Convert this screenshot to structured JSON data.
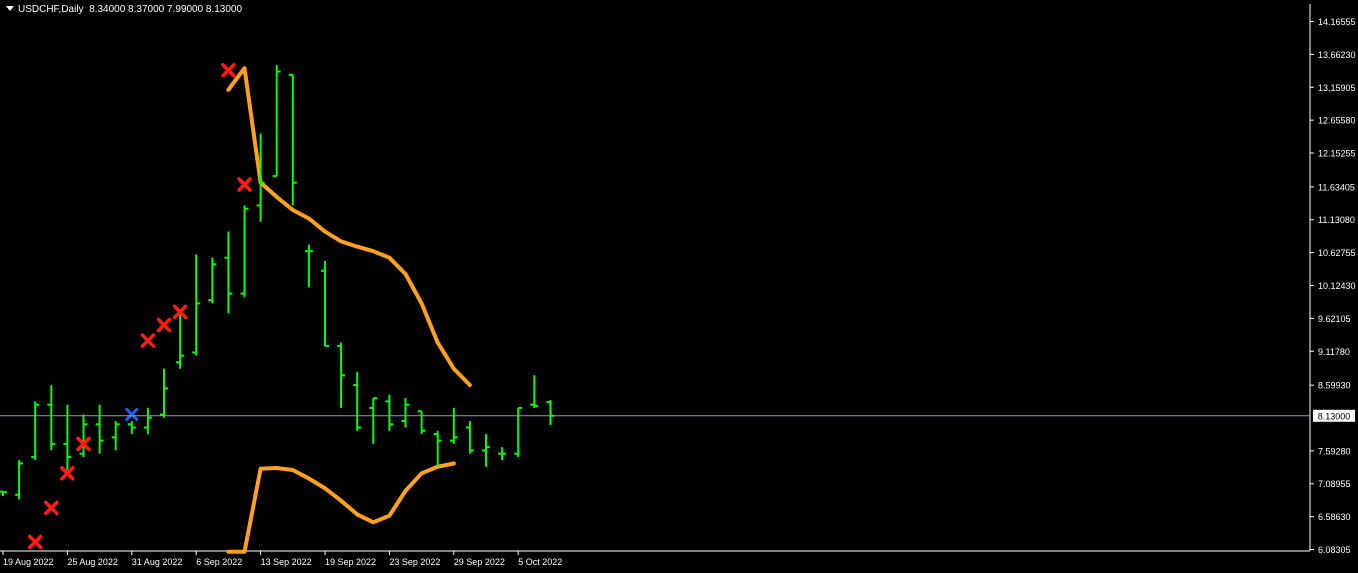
{
  "header": {
    "symbol_timeframe": "USDCHF,Daily",
    "ohlc": "8.34000 8.37000 7.99000 8.13000"
  },
  "colors": {
    "background": "#000000",
    "bars": "#00ff00",
    "band": "#ffa020",
    "marker_red": "#ff1a1a",
    "marker_blue": "#2060ff",
    "axis": "#ffffff",
    "price_line": "#8fa0b8"
  },
  "chart_data": {
    "type": "ohlc",
    "symbol": "USDCHF",
    "timeframe": "Daily",
    "current_price": "8.13000",
    "y_ticks": [
      "14.16555",
      "13.66230",
      "13.15905",
      "12.65580",
      "12.15255",
      "11.63405",
      "11.13080",
      "10.62755",
      "10.12430",
      "9.62105",
      "9.11780",
      "8.59930",
      "7.59280",
      "7.08955",
      "6.58630",
      "6.08305"
    ],
    "ylim": [
      6.05,
      14.3
    ],
    "x_tick_labels": [
      "19 Aug 2022",
      "25 Aug 2022",
      "31 Aug 2022",
      "6 Sep 2022",
      "13 Sep 2022",
      "19 Sep 2022",
      "23 Sep 2022",
      "29 Sep 2022",
      "5 Oct 2022"
    ],
    "x_tick_bar_index": [
      0,
      4,
      8,
      12,
      16,
      20,
      24,
      28,
      32
    ],
    "bars": [
      {
        "o": 6.97,
        "h": 6.97,
        "l": 6.9,
        "c": 6.96
      },
      {
        "o": 6.92,
        "h": 7.45,
        "l": 6.85,
        "c": 7.4
      },
      {
        "o": 7.5,
        "h": 8.35,
        "l": 7.45,
        "c": 8.3
      },
      {
        "o": 8.3,
        "h": 8.6,
        "l": 7.6,
        "c": 7.7
      },
      {
        "o": 7.7,
        "h": 8.3,
        "l": 7.3,
        "c": 7.5
      },
      {
        "o": 7.55,
        "h": 8.15,
        "l": 7.5,
        "c": 8.0
      },
      {
        "o": 8.0,
        "h": 8.3,
        "l": 7.55,
        "c": 7.75
      },
      {
        "o": 7.8,
        "h": 8.05,
        "l": 7.6,
        "c": 8.0
      },
      {
        "o": 8.0,
        "h": 8.05,
        "l": 7.85,
        "c": 7.95
      },
      {
        "o": 7.95,
        "h": 8.25,
        "l": 7.85,
        "c": 8.1
      },
      {
        "o": 8.15,
        "h": 8.85,
        "l": 8.1,
        "c": 8.55
      },
      {
        "o": 8.95,
        "h": 9.7,
        "l": 8.85,
        "c": 9.05
      },
      {
        "o": 9.1,
        "h": 10.6,
        "l": 9.05,
        "c": 9.85
      },
      {
        "o": 9.9,
        "h": 10.55,
        "l": 9.85,
        "c": 10.45
      },
      {
        "o": 10.55,
        "h": 10.95,
        "l": 9.7,
        "c": 10.0
      },
      {
        "o": 10.0,
        "h": 11.35,
        "l": 9.95,
        "c": 11.3
      },
      {
        "o": 11.35,
        "h": 12.45,
        "l": 11.1,
        "c": 11.7
      },
      {
        "o": 11.8,
        "h": 13.5,
        "l": 12.6,
        "c": 13.4
      },
      {
        "o": 13.35,
        "h": 12.65,
        "l": 11.35,
        "c": 11.7
      },
      {
        "o": 10.65,
        "h": 10.75,
        "l": 10.1,
        "c": 10.65
      },
      {
        "o": 10.35,
        "h": 10.5,
        "l": 9.2,
        "c": 9.2
      },
      {
        "o": 9.2,
        "h": 9.25,
        "l": 8.25,
        "c": 8.75
      },
      {
        "o": 8.6,
        "h": 8.8,
        "l": 7.9,
        "c": 7.95
      },
      {
        "o": 8.25,
        "h": 8.4,
        "l": 7.7,
        "c": 8.4
      },
      {
        "o": 8.35,
        "h": 8.45,
        "l": 7.9,
        "c": 8.0
      },
      {
        "o": 8.05,
        "h": 8.4,
        "l": 7.95,
        "c": 8.3
      },
      {
        "o": 8.2,
        "h": 8.2,
        "l": 7.85,
        "c": 7.9
      },
      {
        "o": 7.85,
        "h": 7.9,
        "l": 7.35,
        "c": 7.75
      },
      {
        "o": 7.75,
        "h": 8.25,
        "l": 7.7,
        "c": 7.8
      },
      {
        "o": 7.95,
        "h": 8.05,
        "l": 7.55,
        "c": 7.6
      },
      {
        "o": 7.6,
        "h": 7.85,
        "l": 7.35,
        "c": 7.65
      },
      {
        "o": 7.55,
        "h": 7.65,
        "l": 7.45,
        "c": 7.55
      },
      {
        "o": 7.55,
        "h": 8.25,
        "l": 7.5,
        "c": 8.25
      },
      {
        "o": 8.3,
        "h": 8.75,
        "l": 8.25,
        "c": 8.28
      },
      {
        "o": 8.34,
        "h": 8.37,
        "l": 7.99,
        "c": 8.13
      }
    ],
    "band_upper": [
      [
        14,
        13.12
      ],
      [
        15,
        13.45
      ],
      [
        16,
        11.7
      ],
      [
        17,
        11.48
      ],
      [
        18,
        11.28
      ],
      [
        19,
        11.15
      ],
      [
        20,
        10.95
      ],
      [
        21,
        10.8
      ],
      [
        22,
        10.72
      ],
      [
        23,
        10.65
      ],
      [
        24,
        10.55
      ],
      [
        25,
        10.3
      ],
      [
        26,
        9.85
      ],
      [
        27,
        9.25
      ],
      [
        28,
        8.85
      ],
      [
        29,
        8.6
      ]
    ],
    "band_lower": [
      [
        14,
        6.05
      ],
      [
        15,
        6.05
      ],
      [
        16,
        7.32
      ],
      [
        17,
        7.33
      ],
      [
        18,
        7.3
      ],
      [
        19,
        7.17
      ],
      [
        20,
        7.02
      ],
      [
        21,
        6.83
      ],
      [
        22,
        6.62
      ],
      [
        23,
        6.5
      ],
      [
        24,
        6.6
      ],
      [
        25,
        6.98
      ],
      [
        26,
        7.25
      ],
      [
        27,
        7.35
      ],
      [
        28,
        7.4
      ]
    ],
    "markers_red": [
      [
        2,
        6.2
      ],
      [
        3,
        6.72
      ],
      [
        4,
        7.25
      ],
      [
        5,
        7.7
      ],
      [
        9,
        9.28
      ],
      [
        10,
        9.52
      ],
      [
        11,
        9.72
      ],
      [
        14,
        13.42
      ],
      [
        15,
        11.67
      ]
    ],
    "markers_blue": [
      [
        8,
        8.15
      ]
    ]
  }
}
